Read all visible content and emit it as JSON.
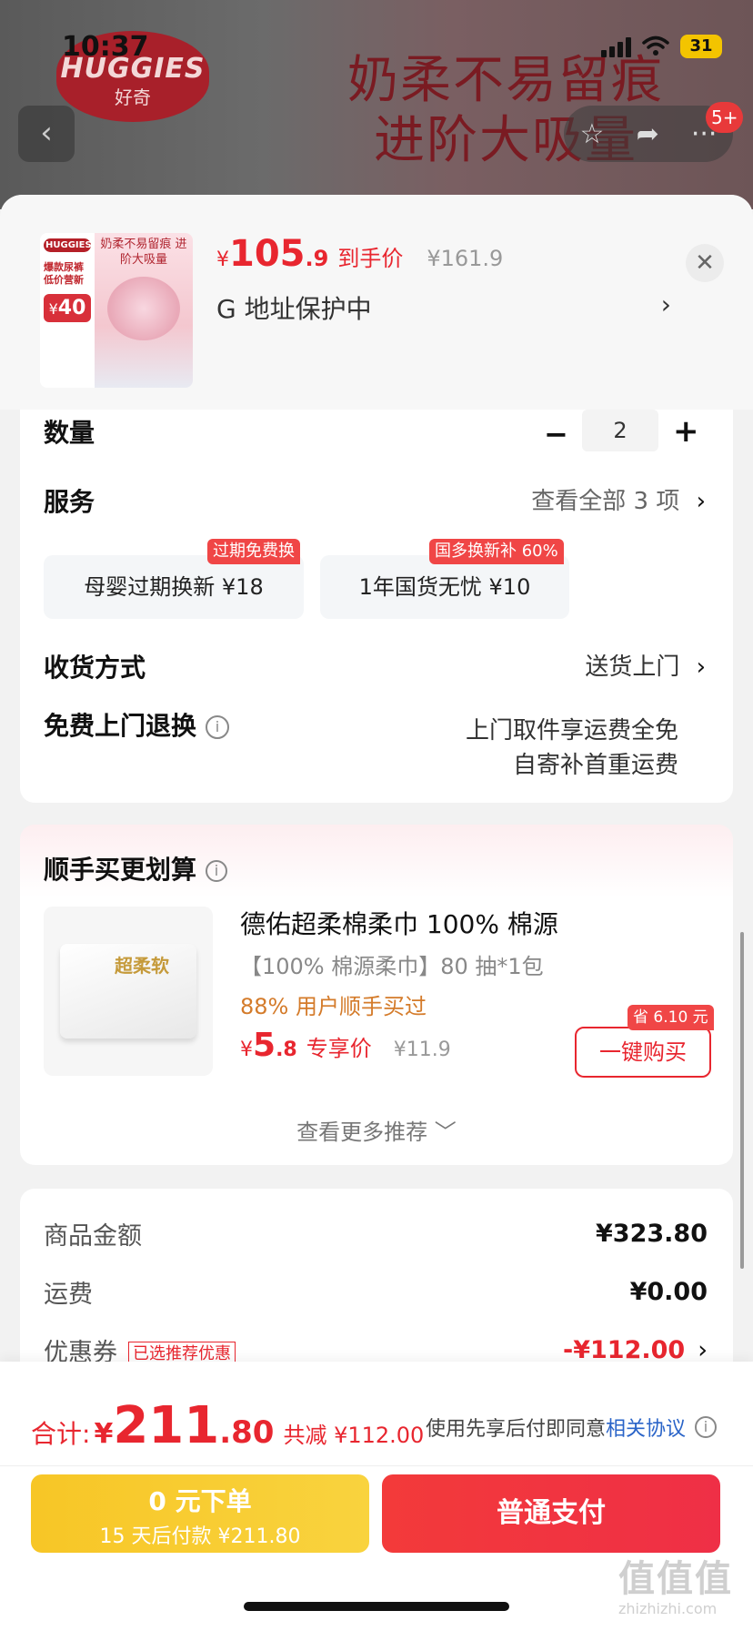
{
  "status_bar": {
    "time": "10:37",
    "battery": "31"
  },
  "banner": {
    "brand": "HUGGIES",
    "brand_cn": "好奇",
    "slogan_line1": "奶柔不易留痕",
    "slogan_line2": "进阶大吸量",
    "badge": "5+"
  },
  "icons": {
    "back": "chevron-left-icon",
    "star": "star-icon",
    "share": "share-icon",
    "more": "more-icon",
    "close": "close-icon",
    "info": "info-icon",
    "chevron": "chevron-right-icon"
  },
  "product": {
    "thumb_brand": "HUGGIES",
    "thumb_text1": "爆款尿裤",
    "thumb_text2": "低价营新",
    "thumb_coupon": "40",
    "thumb_title": "奶柔不易留痕 进阶大吸量",
    "price_currency": "¥",
    "price_int": "105",
    "price_dec": ".9",
    "price_label": "到手价",
    "original_price": "¥161.9",
    "address": "G  地址保护中"
  },
  "options": {
    "qty_label": "数量",
    "qty_value": "2",
    "service_label": "服务",
    "service_all": "查看全部 3 项",
    "services": [
      {
        "name": "母婴过期换新   ¥18",
        "tag": "过期免费换"
      },
      {
        "name": "1年国货无忧   ¥10",
        "tag": "国多换新补 60%"
      }
    ],
    "shipping_label": "收货方式",
    "shipping_value": "送货上门",
    "return_label": "免费上门退换",
    "return_line1": "上门取件享运费全免",
    "return_line2": "自寄补首重运费"
  },
  "recommend": {
    "title": "顺手买更划算",
    "item_name": "德佑超柔棉柔巾 100% 棉源",
    "item_sub": "【100% 棉源柔巾】80 抽*1包",
    "item_buyers": "88% 用户顺手买过",
    "price_currency": "¥",
    "price_int": "5",
    "price_dec": ".8",
    "price_label": "专享价",
    "original_price": "¥11.9",
    "save_tag": "省 6.10 元",
    "buy_button": "一键购买",
    "more": "查看更多推荐 ﹀",
    "pack_text": "超柔软"
  },
  "summary": {
    "goods_label": "商品金额",
    "goods_value": "¥323.80",
    "freight_label": "运费",
    "freight_value": "¥0.00",
    "coupon_label": "优惠券",
    "coupon_tag": "已选推荐优惠",
    "coupon_value": "-¥112.00"
  },
  "footer": {
    "total_label": "合计:",
    "total_currency": "¥",
    "total_int": "211",
    "total_dec": ".80",
    "total_save": "共减 ¥112.00",
    "agree_text": "使用先享后付即同意",
    "agree_link": "相关协议",
    "pay_later_line1": "0 元下单",
    "pay_later_line2": "15 天后付款 ¥211.80",
    "pay_button": "普通支付"
  },
  "watermark": {
    "main": "值值值",
    "sub": "zhizhizhi.com"
  }
}
